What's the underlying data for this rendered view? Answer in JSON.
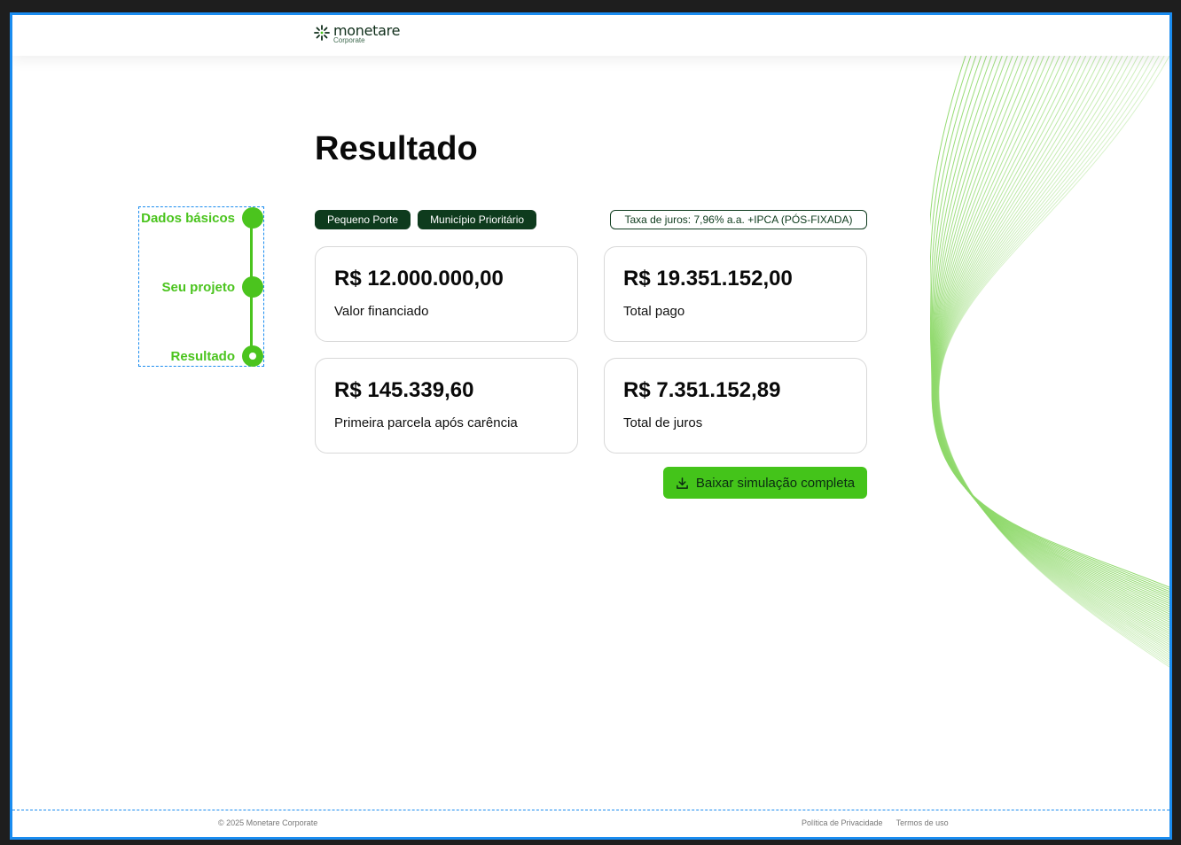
{
  "header": {
    "logo_name": "monetare",
    "logo_sub": "Corporate"
  },
  "page": {
    "title": "Resultado"
  },
  "stepper": {
    "steps": [
      {
        "label": "Dados básicos"
      },
      {
        "label": "Seu projeto"
      },
      {
        "label": "Resultado"
      }
    ]
  },
  "badges": {
    "size": "Pequeno Porte",
    "municipality": "Município Prioritário"
  },
  "rate": {
    "text": "Taxa de juros: 7,96% a.a. +IPCA (PÓS-FIXADA)"
  },
  "cards": [
    {
      "value": "R$ 12.000.000,00",
      "label": "Valor financiado"
    },
    {
      "value": "R$ 19.351.152,00",
      "label": "Total pago"
    },
    {
      "value": "R$ 145.339,60",
      "label": "Primeira parcela após carência"
    },
    {
      "value": "R$ 7.351.152,89",
      "label": "Total de juros"
    }
  ],
  "actions": {
    "download_label": "Baixar simulação completa"
  },
  "footer": {
    "copyright": "© 2025 Monetare Corporate",
    "privacy": "Política de Privacidade",
    "terms": "Termos de uso"
  },
  "colors": {
    "accent": "#44c41a",
    "dark_green": "#0e3b1d",
    "selection": "#1a8cf0"
  }
}
